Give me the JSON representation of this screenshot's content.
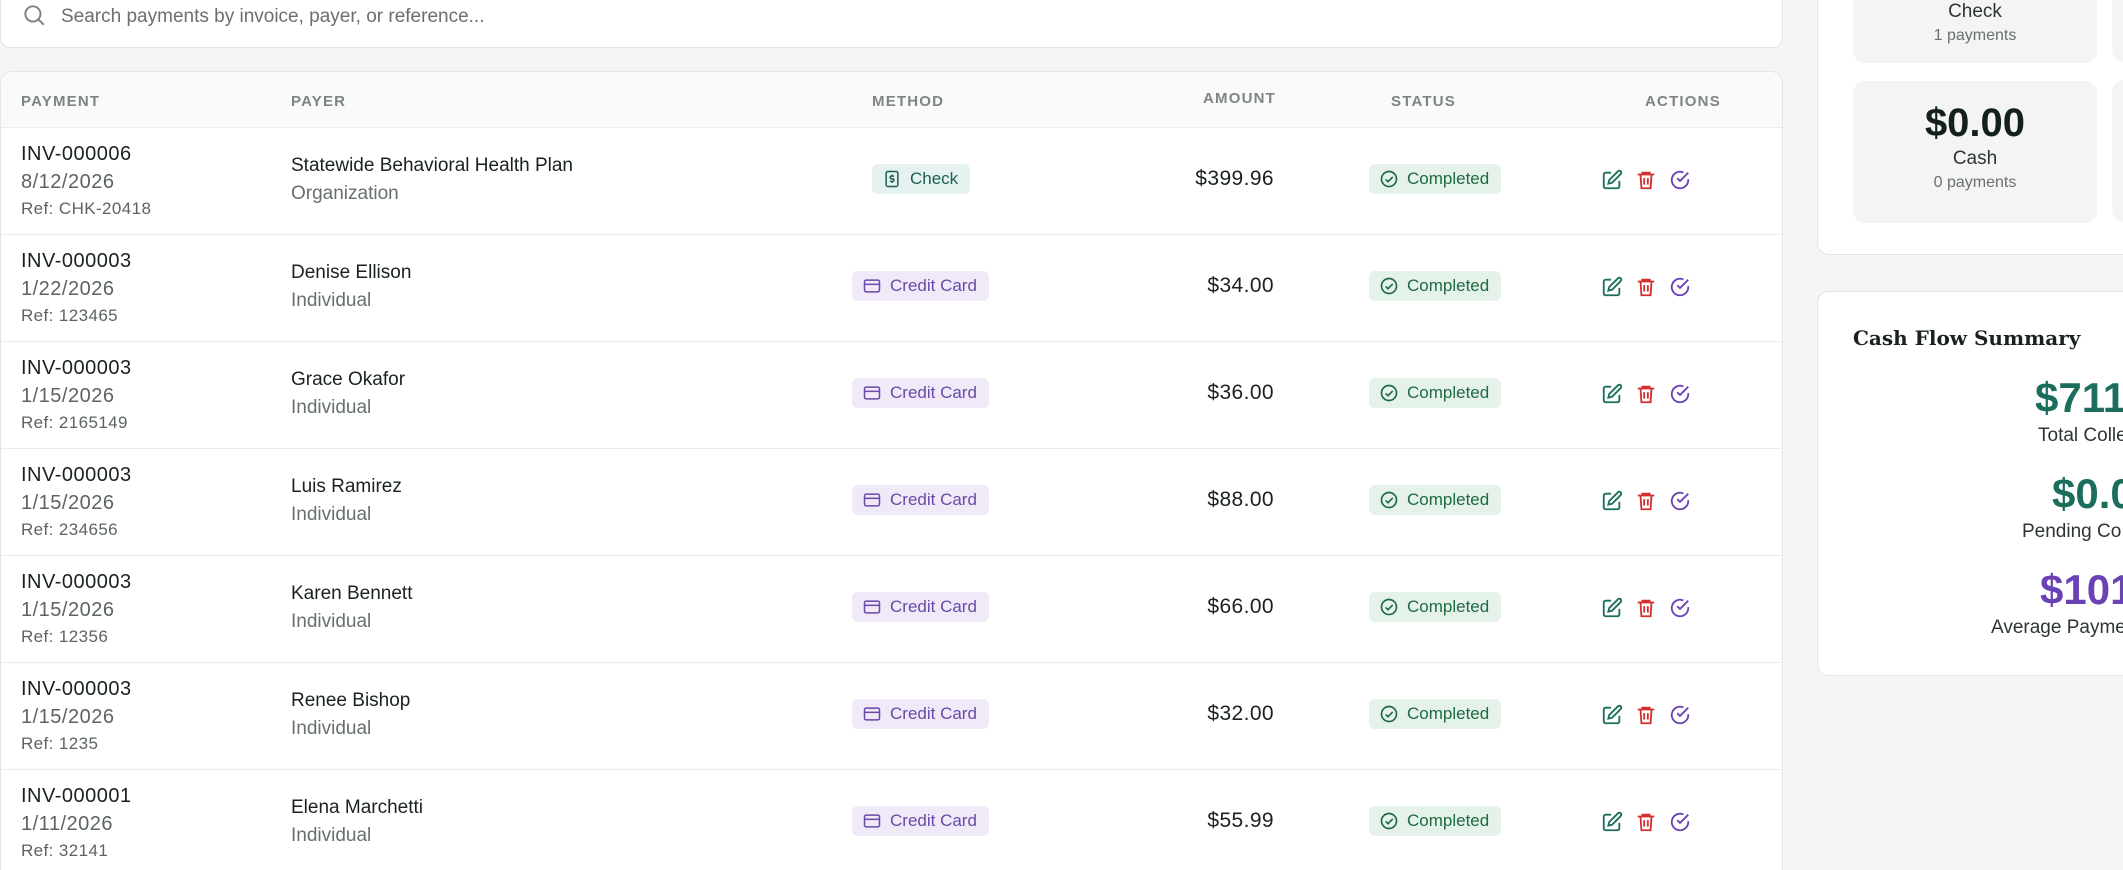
{
  "search": {
    "placeholder": "Search payments by invoice, payer, or reference..."
  },
  "table": {
    "headers": {
      "payment": "PAYMENT",
      "payer": "PAYER",
      "method": "METHOD",
      "amount": "AMOUNT",
      "status": "STATUS",
      "actions": "ACTIONS"
    },
    "rows": [
      {
        "invoice": "INV-000006",
        "date": "8/12/2026",
        "ref": "Ref: CHK-20418",
        "payer": "Statewide Behavioral Health Plan",
        "payer_type": "Organization",
        "method": "Check",
        "amount": "$399.96",
        "status": "Completed"
      },
      {
        "invoice": "INV-000003",
        "date": "1/22/2026",
        "ref": "Ref: 123465",
        "payer": "Denise Ellison",
        "payer_type": "Individual",
        "method": "Credit Card",
        "amount": "$34.00",
        "status": "Completed"
      },
      {
        "invoice": "INV-000003",
        "date": "1/15/2026",
        "ref": "Ref: 2165149",
        "payer": "Grace Okafor",
        "payer_type": "Individual",
        "method": "Credit Card",
        "amount": "$36.00",
        "status": "Completed"
      },
      {
        "invoice": "INV-000003",
        "date": "1/15/2026",
        "ref": "Ref: 234656",
        "payer": "Luis Ramirez",
        "payer_type": "Individual",
        "method": "Credit Card",
        "amount": "$88.00",
        "status": "Completed"
      },
      {
        "invoice": "INV-000003",
        "date": "1/15/2026",
        "ref": "Ref: 12356",
        "payer": "Karen Bennett",
        "payer_type": "Individual",
        "method": "Credit Card",
        "amount": "$66.00",
        "status": "Completed"
      },
      {
        "invoice": "INV-000003",
        "date": "1/15/2026",
        "ref": "Ref: 1235",
        "payer": "Renee Bishop",
        "payer_type": "Individual",
        "method": "Credit Card",
        "amount": "$32.00",
        "status": "Completed"
      },
      {
        "invoice": "INV-000001",
        "date": "1/11/2026",
        "ref": "Ref: 32141",
        "payer": "Elena Marchetti",
        "payer_type": "Individual",
        "method": "Credit Card",
        "amount": "$55.99",
        "status": "Completed"
      }
    ]
  },
  "method_summary": {
    "check": {
      "label": "Check",
      "count": "1 payments"
    },
    "cash": {
      "amount": "$0.00",
      "label": "Cash",
      "count": "0 payments"
    }
  },
  "cash_flow": {
    "title": "Cash Flow Summary",
    "total_value": "$711.",
    "total_label": "Total Colle",
    "pending_value": "$0.0",
    "pending_label": "Pending Co",
    "average_value": "$101",
    "average_label": "Average Payme"
  },
  "colors": {
    "accent_green": "#1b6e5c",
    "accent_purple": "#6a42b5",
    "delete_red": "#d32f2f",
    "status_green": "#1f6a42"
  }
}
